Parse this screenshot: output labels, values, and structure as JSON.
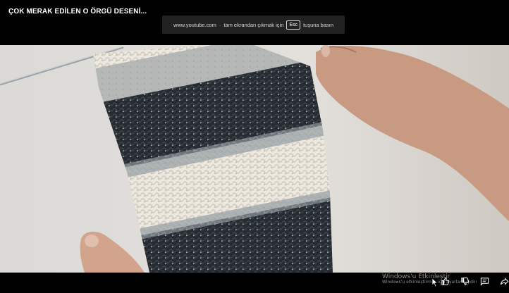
{
  "video": {
    "title": "ÇOK MERAK EDİLEN O ÖRGÜ DESENİ..."
  },
  "fullscreen_notice": {
    "site": "www.youtube.com",
    "separator": "·",
    "text_before_key": "tam ekrandan çıkmak için",
    "key_label": "Esc",
    "text_after_key": "tuşuna basın"
  },
  "watermark": {
    "title": "Windows'u Etkinleştir",
    "subtitle": "Windows'u etkinleştirmek için Ayarlar'a gidin"
  },
  "controls": {
    "icons": [
      "like-icon",
      "dislike-icon",
      "comment-icon",
      "share-icon"
    ]
  },
  "colors": {
    "background": "#000000",
    "notice_bg": "#282828",
    "yarn_cream": "#ece8df",
    "yarn_charcoal": "#262c31",
    "yarn_grey": "#8e969b"
  }
}
